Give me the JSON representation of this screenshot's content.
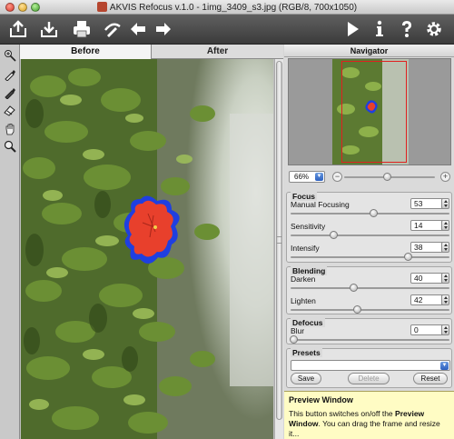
{
  "window": {
    "title": "AKVIS Refocus v.1.0 - 1img_3409_s3.jpg (RGB/8, 700x1050)"
  },
  "toolbar": {
    "left_icons": [
      "open-icon",
      "save-icon",
      "print-icon",
      "brush-settings-icon",
      "undo-icon",
      "redo-icon"
    ],
    "right_icons": [
      "run-icon",
      "info-icon",
      "help-icon",
      "preferences-icon"
    ]
  },
  "left_tools": [
    "focus-brush-icon",
    "background-brush-icon",
    "contour-brush-icon",
    "eraser-icon",
    "hand-icon",
    "zoom-icon"
  ],
  "tabs": [
    {
      "label": "Before",
      "active": true
    },
    {
      "label": "After",
      "active": false
    }
  ],
  "navigator": {
    "title": "Navigator",
    "zoom": "66%"
  },
  "focus": {
    "title": "Focus",
    "params": [
      {
        "label": "Manual Focusing",
        "value": "53"
      },
      {
        "label": "Sensitivity",
        "value": "14"
      },
      {
        "label": "Intensify",
        "value": "38"
      }
    ]
  },
  "blending": {
    "title": "Blending",
    "params": [
      {
        "label": "Darken",
        "value": "40"
      },
      {
        "label": "Lighten",
        "value": "42"
      }
    ]
  },
  "defocus": {
    "title": "Defocus",
    "params": [
      {
        "label": "Blur",
        "value": "0"
      }
    ]
  },
  "presets": {
    "title": "Presets",
    "selected": "",
    "save_label": "Save",
    "delete_label": "Delete",
    "reset_label": "Reset"
  },
  "help": {
    "title": "Preview Window",
    "text_before": "This button switches on/off the ",
    "text_bold": "Preview Window",
    "text_after": ". You can drag the frame and resize it..."
  },
  "colors": {
    "toolbar": "#3b3b3b",
    "focus_outline": "#1f3fe0",
    "flower": "#e8402c",
    "help_bg": "#fffcc4"
  }
}
